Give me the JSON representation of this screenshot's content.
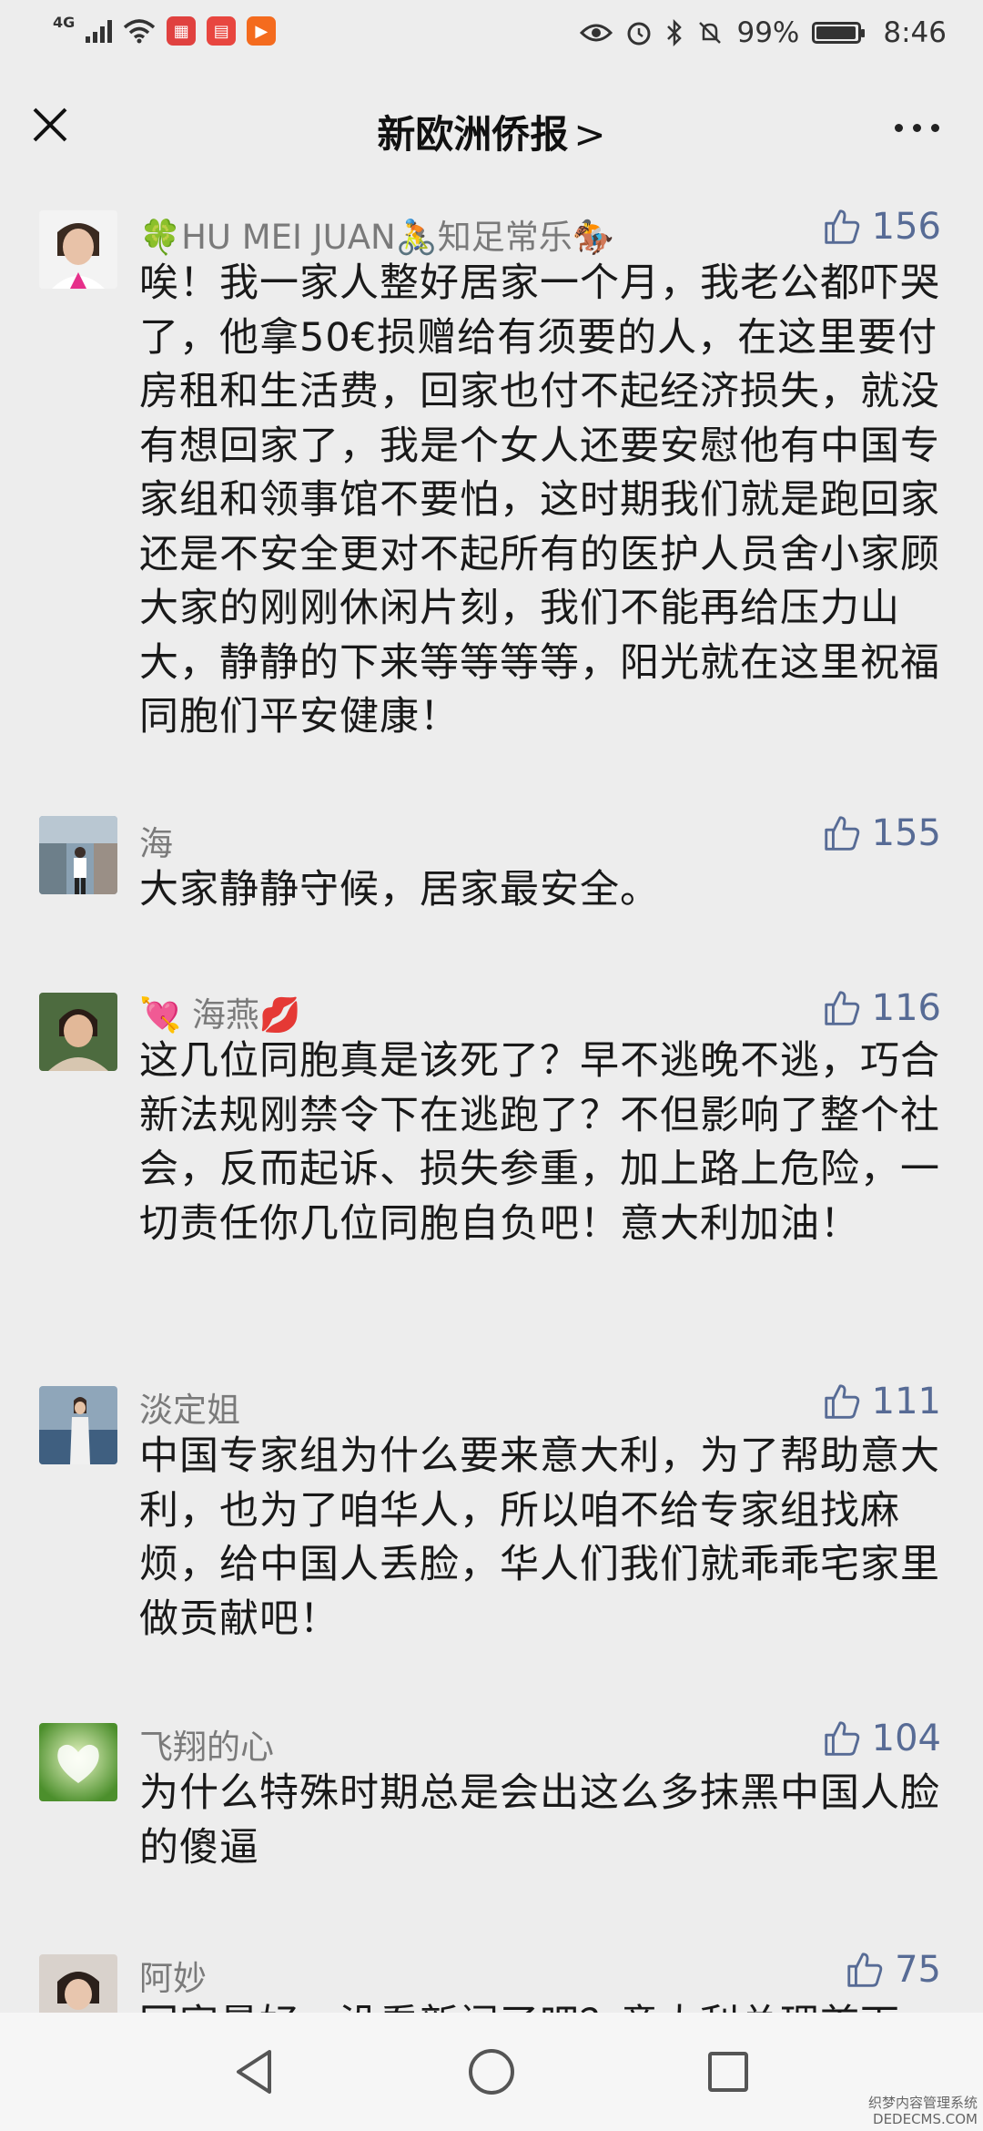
{
  "status_bar": {
    "network": "4G",
    "battery": "99%",
    "time": "8:46",
    "icons": [
      "signal-icon",
      "wifi-icon",
      "calendar-app-icon",
      "book-app-icon",
      "video-app-icon",
      "eye-icon",
      "alarm-icon",
      "bluetooth-icon",
      "mute-icon",
      "battery-icon"
    ]
  },
  "nav": {
    "title": "新欧洲侨报",
    "chevron": ">"
  },
  "comments": [
    {
      "nickname": "🍀HU MEI JUAN🚴知足常乐🏇",
      "likes": "156",
      "text": "唉！我一家人整好居家一个月，我老公都吓哭了，他拿50€损赠给有须要的人，在这里要付房租和生活费，回家也付不起经济损失，就没有想回家了，我是个女人还要安慰他有中国专家组和领事馆不要怕，这时期我们就是跑回家还是不安全更对不起所有的医护人员舍小家顾大家的刚刚休闲片刻，我们不能再给压力山大，静静的下来等等等等，阳光就在这里祝福同胞们平安健康！"
    },
    {
      "nickname": "海",
      "likes": "155",
      "text": "大家静静守候，居家最安全。"
    },
    {
      "nickname": "💘 海燕💋",
      "likes": "116",
      "text": "这几位同胞真是该死了？早不逃晚不逃，巧合新法规刚禁令下在逃跑了？不但影响了整个社会，反而起诉、损失参重，加上路上危险，一切责任你几位同胞自负吧！意大利加油！"
    },
    {
      "nickname": "淡定姐",
      "likes": "111",
      "text": "中国专家组为什么要来意大利，为了帮助意大利，也为了咱华人，所以咱不给专家组找麻烦，给中国人丢脸，华人们我们就乖乖宅家里做贡献吧！"
    },
    {
      "nickname": "飞翔的心",
      "likes": "104",
      "text": "为什么特殊时期总是会出这么多抹黑中国人脸的傻逼"
    },
    {
      "nickname": "阿妙",
      "likes": "75",
      "text": "回家最好，没看新闻了吧？意大利总理首下"
    }
  ],
  "colors": {
    "background": "#ededed",
    "nickname": "#7a7a7a",
    "likes": "#576b95",
    "text": "#191919"
  },
  "watermark": {
    "line1": "织梦内容管理系统",
    "line2": "DEDECMS.COM"
  }
}
